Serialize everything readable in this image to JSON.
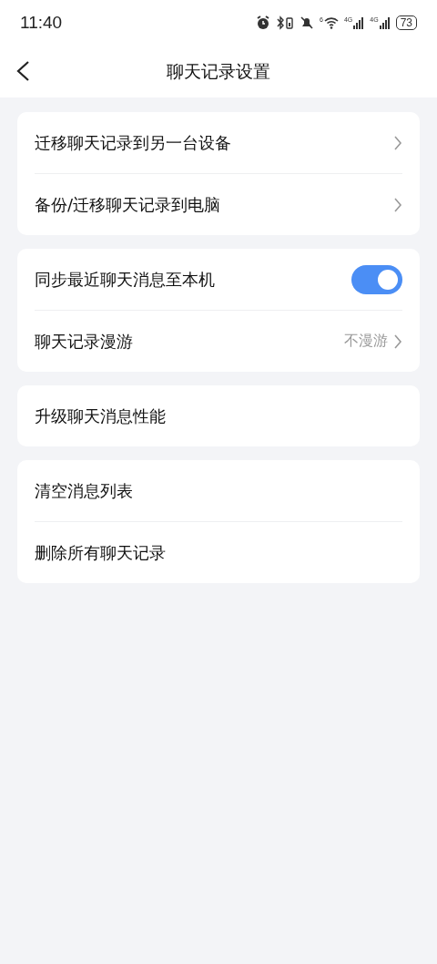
{
  "status_bar": {
    "time": "11:40",
    "wifi_label": "6",
    "cell_labels": [
      "4G",
      "4G"
    ],
    "battery": "73"
  },
  "header": {
    "title": "聊天记录设置"
  },
  "groups": [
    {
      "rows": [
        {
          "kind": "link",
          "label": "迁移聊天记录到另一台设备"
        },
        {
          "kind": "link",
          "label": "备份/迁移聊天记录到电脑"
        }
      ]
    },
    {
      "rows": [
        {
          "kind": "toggle",
          "label": "同步最近聊天消息至本机",
          "on": true
        },
        {
          "kind": "link",
          "label": "聊天记录漫游",
          "value": "不漫游"
        }
      ]
    },
    {
      "rows": [
        {
          "kind": "plain",
          "label": "升级聊天消息性能"
        }
      ]
    },
    {
      "rows": [
        {
          "kind": "plain",
          "label": "清空消息列表"
        },
        {
          "kind": "plain",
          "label": "删除所有聊天记录"
        }
      ]
    }
  ]
}
